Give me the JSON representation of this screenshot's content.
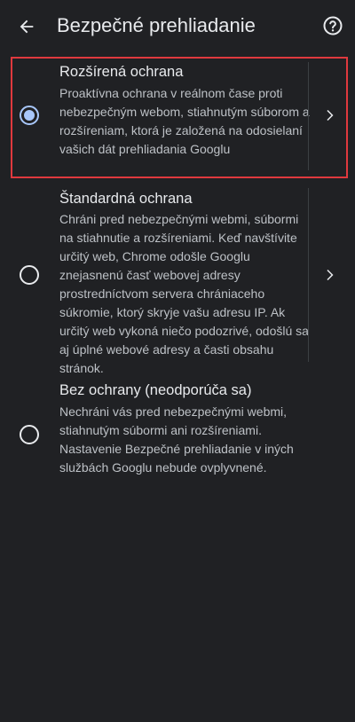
{
  "header": {
    "title": "Bezpečné prehliadanie",
    "back_icon": "arrow-back-icon",
    "help_icon": "help-circle-icon"
  },
  "options": [
    {
      "title": "Rozšírená ochrana",
      "description": "Proaktívna ochrana v reálnom čase proti nebezpečným webom, stiahnutým súborom a rozšíreniam, ktorá je založená na odosielaní vašich dát prehliadania Googlu",
      "selected": true,
      "has_details": true
    },
    {
      "title": "Štandardná ochrana",
      "description": "Chráni pred nebezpečnými webmi, súbormi na stiahnutie a rozšíreniami. Keď navštívite určitý web, Chrome odošle Googlu znejasnenú časť webovej adresy prostredníctvom servera chrániaceho súkromie, ktorý skryje vašu adresu IP. Ak určitý web vykoná niečo podozrivé, odošlú sa aj úplné webové adresy a časti obsahu stránok.",
      "selected": false,
      "has_details": true
    },
    {
      "title": "Bez ochrany (neodporúča sa)",
      "description": "Nechráni vás pred nebezpečnými webmi, stiahnutým súbormi ani rozšíreniami. Nastavenie Bezpečné prehliadanie v iných službách Googlu nebude ovplyvnené.",
      "selected": false,
      "has_details": false
    }
  ],
  "colors": {
    "background": "#202124",
    "text_primary": "#e8eaed",
    "text_secondary": "#bdc1c6",
    "radio_selected": "#a8c7fa",
    "highlight_border": "#e0393e"
  }
}
